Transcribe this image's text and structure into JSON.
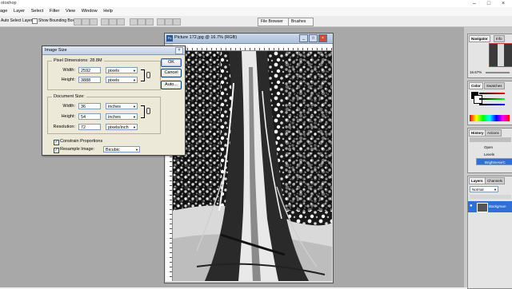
{
  "app": {
    "title": "otoshop"
  },
  "menu": [
    "age",
    "Layer",
    "Select",
    "Filter",
    "View",
    "Window",
    "Help"
  ],
  "options_bar": {
    "auto_select_label": "Auto Select Layer",
    "show_bounding_label": "Show Bounding Box",
    "tabs": [
      "File Browser",
      "Brushes"
    ]
  },
  "document": {
    "title": "Picture 172.jpg @ 16.7% (RGB)"
  },
  "dialog": {
    "title": "Image Size",
    "pixel_dimensions": {
      "legend": "Pixel Dimensions:",
      "size": "28.8M",
      "width_label": "Width:",
      "width_value": "2592",
      "width_unit": "pixels",
      "height_label": "Height:",
      "height_value": "3888",
      "height_unit": "pixels"
    },
    "document_size": {
      "legend": "Document Size:",
      "width_label": "Width:",
      "width_value": "36",
      "width_unit": "inches",
      "height_label": "Height:",
      "height_value": "54",
      "height_unit": "inches",
      "resolution_label": "Resolution:",
      "resolution_value": "72",
      "resolution_unit": "pixels/inch"
    },
    "constrain_label": "Constrain Proportions",
    "resample_label": "Resample Image:",
    "resample_value": "Bicubic",
    "buttons": {
      "ok": "OK",
      "cancel": "Cancel",
      "auto": "Auto..."
    }
  },
  "panels": {
    "navigator": {
      "tabs": [
        "Navigator",
        "Info"
      ],
      "zoom": "16.67%"
    },
    "color": {
      "tabs": [
        "Color",
        "Swatches"
      ]
    },
    "history": {
      "tabs": [
        "History",
        "Actions"
      ],
      "rows": [
        "Open",
        "Levels",
        "Brightness/C"
      ]
    },
    "layers": {
      "tabs": [
        "Layers",
        "Channels"
      ],
      "blend_mode": "Normal",
      "layer_name": "Backgroun"
    }
  }
}
